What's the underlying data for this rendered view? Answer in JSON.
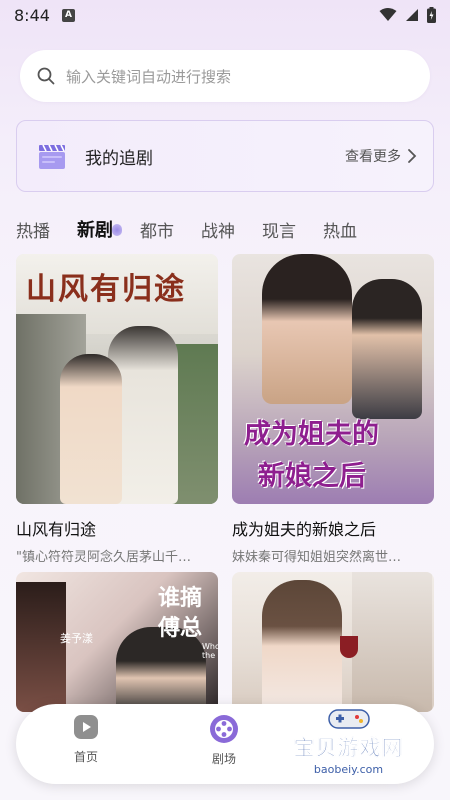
{
  "status_bar": {
    "time": "8:44",
    "badge": "A"
  },
  "search": {
    "placeholder": "输入关键词自动进行搜索"
  },
  "follow": {
    "title": "我的追剧",
    "more": "查看更多"
  },
  "tabs": [
    {
      "label": "热播"
    },
    {
      "label": "新剧"
    },
    {
      "label": "都市"
    },
    {
      "label": "战神"
    },
    {
      "label": "现言"
    },
    {
      "label": "热血"
    }
  ],
  "active_tab": "新剧",
  "dramas": [
    {
      "poster_text": "山风有归途",
      "title": "山风有归途",
      "desc": "\"镇心符符灵阿念久居茅山千…"
    },
    {
      "poster_text_1": "成为姐夫的",
      "poster_text_2": "新娘之后",
      "title": "成为姐夫的新娘之后",
      "desc": "妹妹秦可得知姐姐突然离世…"
    },
    {
      "poster_text_1": "谁摘",
      "poster_text_2": "傅总",
      "poster_sub": "姜予漾",
      "poster_en": "Who\nthe bos",
      "title": "",
      "desc": ""
    },
    {
      "title": "",
      "desc": ""
    }
  ],
  "bottom_nav": [
    {
      "label": "首页"
    },
    {
      "label": "剧场"
    }
  ],
  "watermark": {
    "text": "宝贝游戏网",
    "url": "baobeiy.com"
  },
  "colors": {
    "accent": "#8a6ad8",
    "background": "#f7f3fb",
    "card_border": "#d9cdef"
  }
}
